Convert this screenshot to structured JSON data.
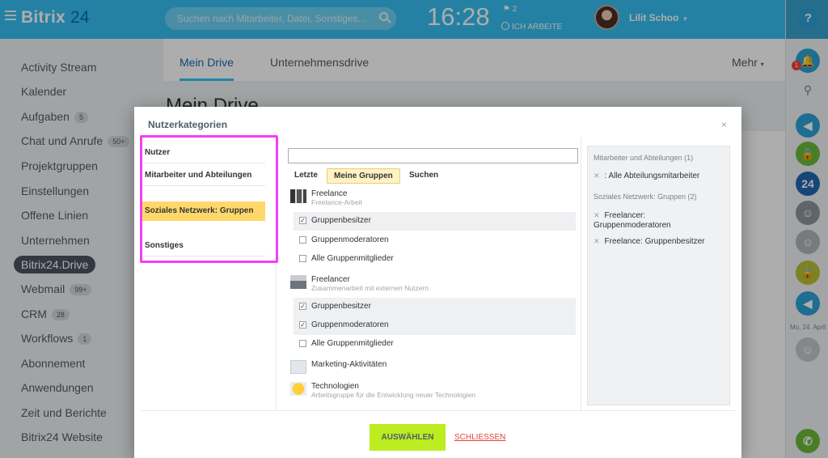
{
  "header": {
    "logo_main": "Bitrix",
    "logo_num": "24",
    "search_placeholder": "Suchen nach Mitarbeiter, Datei, Sonstiges...",
    "time": "16:28",
    "flag_count": "2",
    "status": "ICH ARBEITE",
    "user_name": "Lilit Schoo"
  },
  "sidebar": {
    "items": [
      {
        "label": "Activity Stream",
        "badge": ""
      },
      {
        "label": "Kalender",
        "badge": ""
      },
      {
        "label": "Aufgaben",
        "badge": "5"
      },
      {
        "label": "Chat und Anrufe",
        "badge": "50+"
      },
      {
        "label": "Projektgruppen",
        "badge": ""
      },
      {
        "label": "Einstellungen",
        "badge": ""
      },
      {
        "label": "Offene Linien",
        "badge": ""
      },
      {
        "label": "Unternehmen",
        "badge": ""
      },
      {
        "label": "Bitrix24.Drive",
        "badge": ""
      },
      {
        "label": "Webmail",
        "badge": "99+"
      },
      {
        "label": "CRM",
        "badge": "28"
      },
      {
        "label": "Workflows",
        "badge": "1"
      },
      {
        "label": "Abonnement",
        "badge": ""
      },
      {
        "label": "Anwendungen",
        "badge": ""
      },
      {
        "label": "Zeit und Berichte",
        "badge": ""
      },
      {
        "label": "Bitrix24 Website",
        "badge": ""
      }
    ]
  },
  "page": {
    "tab_my": "Mein Drive",
    "tab_company": "Unternehmensdrive",
    "tab_more": "Mehr",
    "title": "Mein Drive"
  },
  "rightrail": {
    "help": "?",
    "bell_badge": "1",
    "date": "Mo, 24. April"
  },
  "dialog": {
    "title": "Nutzerkategorien",
    "close": "×",
    "categories": [
      "Nutzer",
      "Mitarbeiter und Abteilungen",
      "Soziales Netzwerk: Gruppen",
      "Sonstiges"
    ],
    "tabs": [
      "Letzte",
      "Meine Gruppen",
      "Suchen"
    ],
    "groups": [
      {
        "name": "Freelance",
        "sub": "Freelance-Arbeit"
      },
      {
        "name": "Freelancer",
        "sub": "Zusammenarbeit mit externen Nutzern"
      },
      {
        "name": "Marketing-Aktivitäten",
        "sub": ""
      },
      {
        "name": "Technologien",
        "sub": "Arbeitsgruppe für die Entwicklung neuer Technologien"
      }
    ],
    "options": {
      "owners": "Gruppenbesitzer",
      "moderators": "Gruppenmoderatoren",
      "members": "Alle Gruppenmitglieder"
    },
    "selected": {
      "head1": "Mitarbeiter und Abteilungen (1)",
      "item1": ": Alle Abteilungsmitarbeiter",
      "head2": "Soziales Netzwerk: Gruppen (2)",
      "item2": "Freelancer: Gruppenmoderatoren",
      "item3": "Freelance: Gruppenbesitzer"
    },
    "btn_select": "AUSWÄHLEN",
    "btn_close": "SCHLIESSEN"
  },
  "colors": {
    "header": "#35bff0",
    "accent_select": "#bbed21",
    "active_category": "#ffd86b",
    "highlight_frame": "#f43ef7",
    "close_link": "#e0463a"
  }
}
